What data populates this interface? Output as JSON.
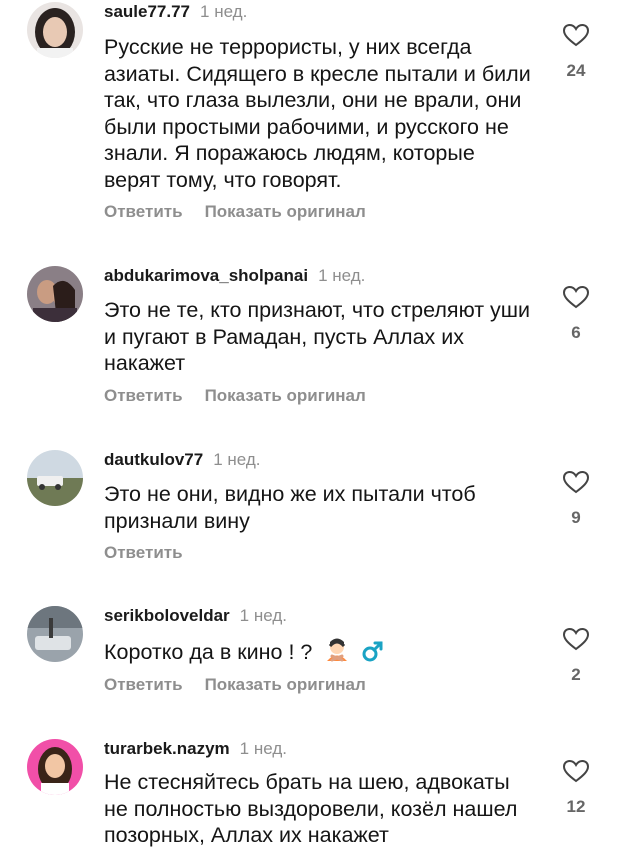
{
  "labels": {
    "reply": "Ответить",
    "show_original": "Показать оригинал"
  },
  "comments": [
    {
      "username": "saule77.77",
      "time": "1 нед.",
      "text": "Русские не террористы, у них всегда азиаты. Сидящего в кресле пытали и били так, что глаза вылезли, они не врали, они были простыми рабочими, и русского не знали. Я поражаюсь людям, которые верят тому, что говорят.",
      "likes": "24"
    },
    {
      "username": "abdukarimova_sholpanai",
      "time": "1 нед.",
      "text": "Это не те, кто признают, что стреляют уши и пугают в Рамадан, пусть Аллах их накажет",
      "likes": "6"
    },
    {
      "username": "dautkulov77",
      "time": "1 нед.",
      "text": "Это не они, видно же их пытали чтоб признали вину",
      "likes": "9"
    },
    {
      "username": "serikboloveldar",
      "time": "1 нед.",
      "text": "Коротко да в кино ! ?",
      "emoji": [
        "person-gesturing-no-emoji",
        "male-sign-emoji"
      ],
      "likes": "2"
    },
    {
      "username": "turarbek.nazym",
      "time": "1 нед.",
      "text": "Не стесняйтесь брать на шею, адвокаты не полностью выздоровели, козёл нашел позорных, Аллах их накажет",
      "likes": "12"
    }
  ],
  "colors": {
    "text": "#151515",
    "muted": "#8e8e8e",
    "male_sign": "#1aa3c4"
  }
}
